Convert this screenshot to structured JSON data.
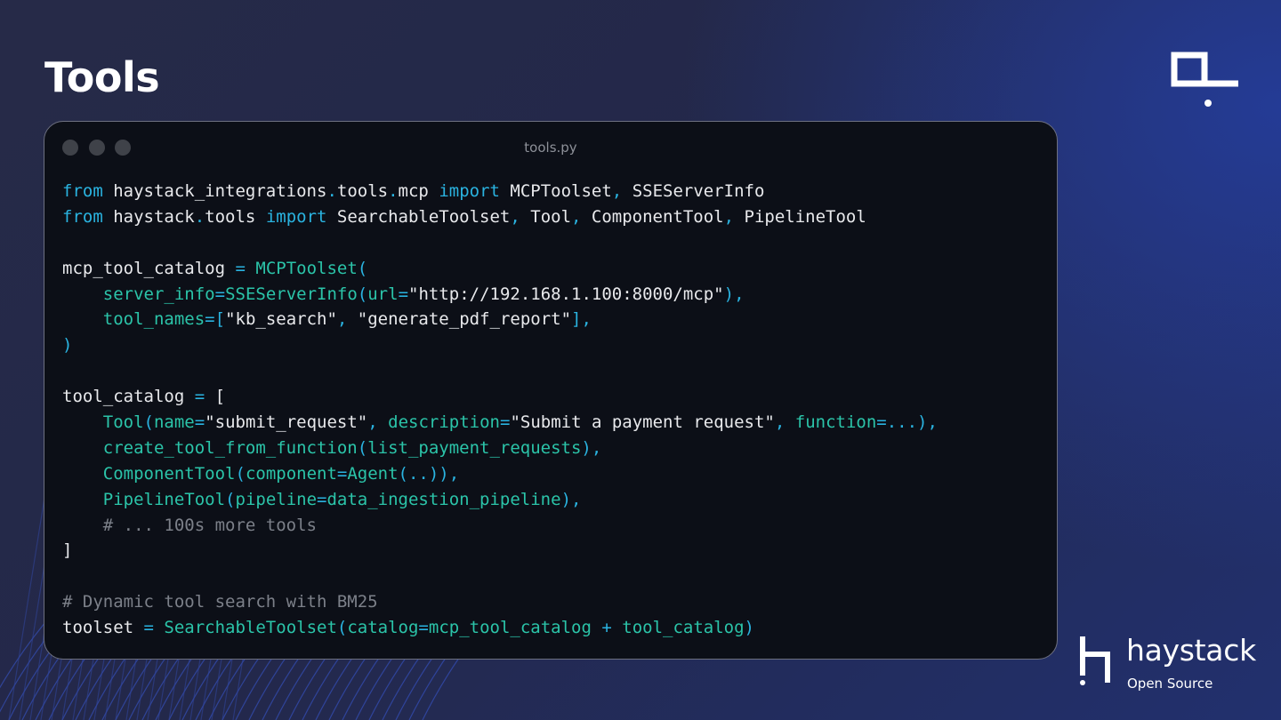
{
  "slide": {
    "title": "Tools"
  },
  "code_window": {
    "filename": "tools.py",
    "lines": [
      [
        [
          "kw",
          "from"
        ],
        [
          "tx",
          " haystack_integrations"
        ],
        [
          "kw",
          "."
        ],
        [
          "tx",
          "tools"
        ],
        [
          "kw",
          "."
        ],
        [
          "tx",
          "mcp "
        ],
        [
          "kw",
          "import"
        ],
        [
          "tx",
          " MCPToolset"
        ],
        [
          "pu",
          ","
        ],
        [
          "tx",
          " SSEServerInfo"
        ]
      ],
      [
        [
          "kw",
          "from"
        ],
        [
          "tx",
          " haystack"
        ],
        [
          "kw",
          "."
        ],
        [
          "tx",
          "tools "
        ],
        [
          "kw",
          "import"
        ],
        [
          "tx",
          " SearchableToolset"
        ],
        [
          "pu",
          ","
        ],
        [
          "tx",
          " Tool"
        ],
        [
          "pu",
          ","
        ],
        [
          "tx",
          " ComponentTool"
        ],
        [
          "pu",
          ","
        ],
        [
          "tx",
          " PipelineTool"
        ]
      ],
      [],
      [
        [
          "tx",
          "mcp_tool_catalog "
        ],
        [
          "kw",
          "="
        ],
        [
          "tx",
          " "
        ],
        [
          "fn",
          "MCPToolset"
        ],
        [
          "pu",
          "("
        ]
      ],
      [
        [
          "tx",
          "    "
        ],
        [
          "fn",
          "server_info"
        ],
        [
          "kw",
          "="
        ],
        [
          "fn",
          "SSEServerInfo"
        ],
        [
          "pu",
          "("
        ],
        [
          "fn",
          "url"
        ],
        [
          "kw",
          "="
        ],
        [
          "tx",
          "\"http://192.168.1.100:8000/mcp\""
        ],
        [
          "pu",
          "),"
        ]
      ],
      [
        [
          "tx",
          "    "
        ],
        [
          "fn",
          "tool_names"
        ],
        [
          "kw",
          "="
        ],
        [
          "pu",
          "["
        ],
        [
          "tx",
          "\"kb_search\""
        ],
        [
          "pu",
          ","
        ],
        [
          "tx",
          " \"generate_pdf_report\""
        ],
        [
          "pu",
          "],"
        ]
      ],
      [
        [
          "pu",
          ")"
        ]
      ],
      [],
      [
        [
          "tx",
          "tool_catalog "
        ],
        [
          "kw",
          "="
        ],
        [
          "tx",
          " ["
        ]
      ],
      [
        [
          "tx",
          "    "
        ],
        [
          "fn",
          "Tool"
        ],
        [
          "pu",
          "("
        ],
        [
          "fn",
          "name"
        ],
        [
          "kw",
          "="
        ],
        [
          "tx",
          "\"submit_request\""
        ],
        [
          "pu",
          ","
        ],
        [
          "tx",
          " "
        ],
        [
          "fn",
          "description"
        ],
        [
          "kw",
          "="
        ],
        [
          "tx",
          "\"Submit a payment request\""
        ],
        [
          "pu",
          ","
        ],
        [
          "tx",
          " "
        ],
        [
          "fn",
          "function"
        ],
        [
          "kw",
          "=..."
        ],
        [
          "pu",
          "),"
        ]
      ],
      [
        [
          "tx",
          "    "
        ],
        [
          "fn",
          "create_tool_from_function"
        ],
        [
          "pu",
          "("
        ],
        [
          "fn",
          "list_payment_requests"
        ],
        [
          "pu",
          "),"
        ]
      ],
      [
        [
          "tx",
          "    "
        ],
        [
          "fn",
          "ComponentTool"
        ],
        [
          "pu",
          "("
        ],
        [
          "fn",
          "component"
        ],
        [
          "kw",
          "="
        ],
        [
          "fn",
          "Agent"
        ],
        [
          "pu",
          "(..)),"
        ]
      ],
      [
        [
          "tx",
          "    "
        ],
        [
          "fn",
          "PipelineTool"
        ],
        [
          "pu",
          "("
        ],
        [
          "fn",
          "pipeline"
        ],
        [
          "kw",
          "="
        ],
        [
          "fn",
          "data_ingestion_pipeline"
        ],
        [
          "pu",
          "),"
        ]
      ],
      [
        [
          "tx",
          "    "
        ],
        [
          "cm",
          "# ... 100s more tools"
        ]
      ],
      [
        [
          "tx",
          "]"
        ]
      ],
      [],
      [
        [
          "cm",
          "# Dynamic tool search with BM25"
        ]
      ],
      [
        [
          "tx",
          "toolset "
        ],
        [
          "kw",
          "="
        ],
        [
          "tx",
          " "
        ],
        [
          "fn",
          "SearchableToolset"
        ],
        [
          "pu",
          "("
        ],
        [
          "fn",
          "catalog"
        ],
        [
          "kw",
          "="
        ],
        [
          "fn",
          "mcp_tool_catalog"
        ],
        [
          "tx",
          " "
        ],
        [
          "kw",
          "+"
        ],
        [
          "tx",
          " "
        ],
        [
          "fn",
          "tool_catalog"
        ],
        [
          "pu",
          ")"
        ]
      ]
    ]
  },
  "brand": {
    "name": "haystack",
    "subtitle": "Open Source"
  },
  "colors": {
    "keyword": "#2ab3e0",
    "function": "#2bc4a9",
    "comment": "#7c8089",
    "text": "#e8e9ec",
    "code_background": "#0c0f17",
    "slide_background": "#252a4a"
  },
  "icons": {
    "corner": "deepset-bracket-logo",
    "brand": "haystack-h-logo",
    "window_controls": [
      "window-dot-icon",
      "window-dot-icon",
      "window-dot-icon"
    ]
  }
}
